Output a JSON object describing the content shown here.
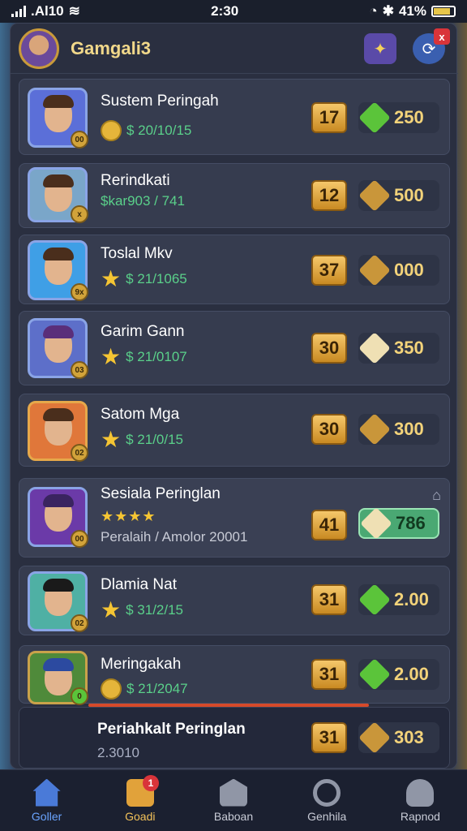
{
  "status_bar": {
    "carrier": ".Al10",
    "time": "2:30",
    "battery": "41%"
  },
  "header": {
    "title": "Gamgali3",
    "close_badge": "x"
  },
  "rows": [
    {
      "name": "Sustem Peringah",
      "subtitle": "$ 20/10/15",
      "level": "17",
      "score": "250",
      "gem": "green",
      "reward": "coin",
      "badge": "00"
    },
    {
      "name": "Rerindkati",
      "subtitle": "$kar903 / 741",
      "level": "12",
      "score": "500",
      "gem": "amber",
      "reward": "none",
      "badge": "x"
    },
    {
      "name": "Toslal Mkv",
      "subtitle": "$ 21/1065",
      "level": "37",
      "score": "000",
      "gem": "amber",
      "reward": "star",
      "badge": "9x"
    },
    {
      "name": "Garim Gann",
      "subtitle": "$ 21/0107",
      "level": "30",
      "score": "350",
      "gem": "cream",
      "reward": "star",
      "badge": "03"
    },
    {
      "name": "Satom Mga",
      "subtitle": "$ 21/0/15",
      "level": "30",
      "score": "300",
      "gem": "amber",
      "reward": "star",
      "badge": "02"
    },
    {
      "name": "Sesiala Peringlan",
      "subtitle": "Peralaih / Amolor 20001",
      "level": "41",
      "score": "786",
      "gem": "cream",
      "reward": "stars4",
      "badge": "00"
    },
    {
      "name": "Dlamia Nat",
      "subtitle": "$ 31/2/15",
      "level": "31",
      "score": "2.00",
      "gem": "green",
      "reward": "star",
      "badge": "02"
    },
    {
      "name": "Meringakah",
      "subtitle": "$ 21/2047",
      "level": "31",
      "score": "2.00",
      "gem": "green",
      "reward": "coin",
      "badge": "0"
    }
  ],
  "sub_row": {
    "name": "Periahkalt Peringlan",
    "subtitle": "2.3010",
    "level": "31",
    "score": "303"
  },
  "nav": [
    {
      "label": "Goller",
      "badge": ""
    },
    {
      "label": "Goadi",
      "badge": "1"
    },
    {
      "label": "Baboan",
      "badge": ""
    },
    {
      "label": "Genhila",
      "badge": ""
    },
    {
      "label": "Rapnod",
      "badge": ""
    }
  ]
}
